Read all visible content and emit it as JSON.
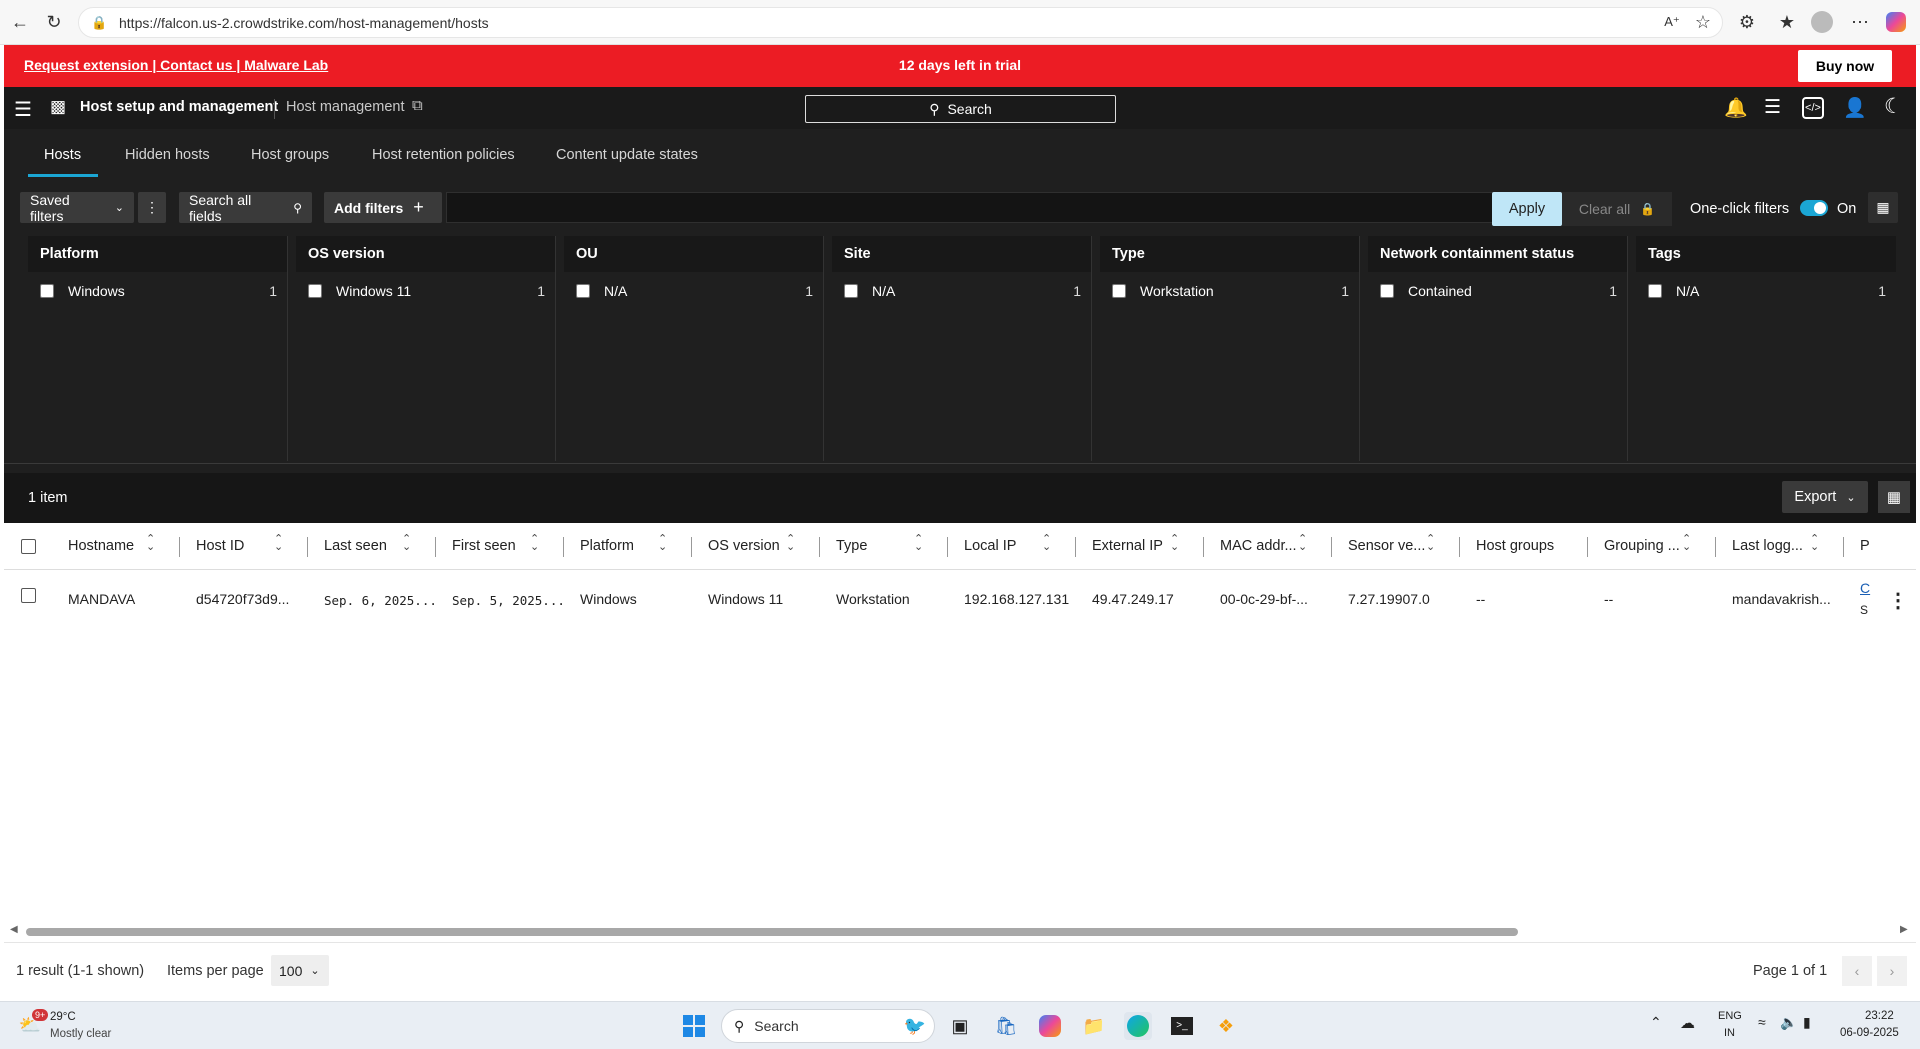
{
  "browser": {
    "url": "https://falcon.us-2.crowdstrike.com/host-management/hosts"
  },
  "banner": {
    "links": "Request extension | Contact us | Malware Lab",
    "message": "12 days left in trial",
    "buy_label": "Buy now",
    "color": "#ec1c24"
  },
  "nav": {
    "app_title": "Host setup and management",
    "page_title": "Host management",
    "search_label": "Search"
  },
  "tabs": [
    "Hosts",
    "Hidden hosts",
    "Host groups",
    "Host retention policies",
    "Content update states"
  ],
  "filters": {
    "saved_filters": "Saved filters",
    "search_all_fields": "Search all fields",
    "add_filters": "Add filters",
    "apply": "Apply",
    "clear_all": "Clear all",
    "one_click_label": "One-click filters",
    "one_click_state": "On"
  },
  "facets": [
    {
      "title": "Platform",
      "value": "Windows",
      "count": "1"
    },
    {
      "title": "OS version",
      "value": "Windows 11",
      "count": "1"
    },
    {
      "title": "OU",
      "value": "N/A",
      "count": "1"
    },
    {
      "title": "Site",
      "value": "N/A",
      "count": "1"
    },
    {
      "title": "Type",
      "value": "Workstation",
      "count": "1"
    },
    {
      "title": "Network containment status",
      "value": "Contained",
      "count": "1"
    },
    {
      "title": "Tags",
      "value": "N/A",
      "count": "1"
    }
  ],
  "results": {
    "item_count": "1 item",
    "export_label": "Export"
  },
  "table": {
    "columns": [
      "Hostname",
      "Host ID",
      "Last seen",
      "First seen",
      "Platform",
      "OS version",
      "Type",
      "Local IP",
      "External IP",
      "MAC addr...",
      "Sensor ve...",
      "Host groups",
      "Grouping ...",
      "Last logg...",
      "P"
    ],
    "row": {
      "hostname": "MANDAVA",
      "host_id": "d54720f73d9...",
      "last_seen": "Sep. 6, 2025...",
      "first_seen": "Sep. 5, 2025...",
      "platform": "Windows",
      "os_version": "Windows 11",
      "type": "Workstation",
      "local_ip": "192.168.127.131",
      "external_ip": "49.47.249.17",
      "mac": "00-0c-29-bf-...",
      "sensor": "7.27.19907.0",
      "host_groups": "--",
      "grouping": "--",
      "last_logged": "mandavakrish...",
      "p_line1": "C",
      "p_line2": "S"
    }
  },
  "pager": {
    "result_text": "1 result (1-1 shown)",
    "items_per_page_label": "Items per page",
    "items_per_page": "100",
    "page_text": "Page 1 of 1"
  },
  "taskbar": {
    "weather_temp": "29°C",
    "weather_desc": "Mostly clear",
    "weather_badge": "9+",
    "search_placeholder": "Search",
    "lang_line1": "ENG",
    "lang_line2": "IN",
    "time": "23:22",
    "date": "06-09-2025"
  }
}
